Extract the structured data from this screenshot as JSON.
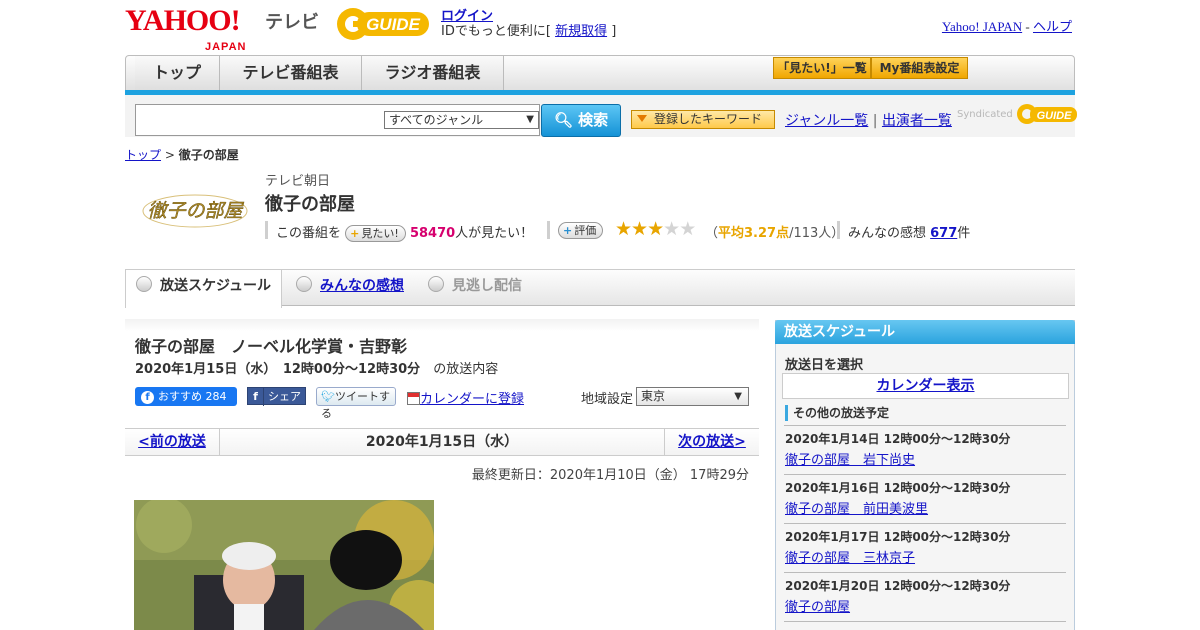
{
  "header": {
    "yahoo_logo": "YAHOO!",
    "yahoo_japan": "JAPAN",
    "tv_label": "テレビ",
    "gguide_logo": "GUIDE",
    "login": "ログイン",
    "id_text_prefix": "IDでもっと便利に[ ",
    "signup": "新規取得",
    "id_text_suffix": " ]",
    "yahoo_japan_link": "Yahoo! JAPAN",
    "sep": " - ",
    "help": "ヘルプ"
  },
  "nav": {
    "tabs": [
      "トップ",
      "テレビ番組表",
      "ラジオ番組表"
    ],
    "mitai_list": "「見たい!」一覧",
    "my_bangumi": "My番組表設定"
  },
  "search": {
    "genre_selected": "すべてのジャンル",
    "button": "検索",
    "keyword_button": "登録したキーワード",
    "genre_list": "ジャンル一覧",
    "divider": " | ",
    "performer_list": "出演者一覧",
    "syndicated": "Syndicated",
    "syndicated_logo": "GUIDE"
  },
  "breadcrumb": {
    "top": "トップ",
    "sep": " > ",
    "current": "徹子の部屋"
  },
  "program": {
    "logo_text": "徹子の部屋",
    "channel": "テレビ朝日",
    "title": "徹子の部屋",
    "mitai_prefix": "この番組を",
    "mitai_button": "見たい!",
    "mitai_count": "58470",
    "mitai_suffix": "人が見たい！",
    "hyoka_button": "評価",
    "rating_stars": 3,
    "rating_max": 5,
    "avg_open": "（",
    "avg_value": "平均3.27点",
    "avg_count": "/113人",
    "avg_close": "）",
    "kanso_label": "みんなの感想 ",
    "kanso_count": "677",
    "kanso_unit": "件"
  },
  "tabs": {
    "schedule": "放送スケジュール",
    "reviews": "みんなの感想",
    "streaming": "見逃し配信"
  },
  "episode": {
    "title": "徹子の部屋　ノーベル化学賞・吉野彰",
    "date": "2020年1月15日（水）　12時00分～12時30分",
    "date_suffix": "の放送内容",
    "fb_label": "おすすめ",
    "fb_count": "284",
    "share": "シェア",
    "tweet": "ツイートする",
    "calendar": "カレンダーに登録",
    "region_label": "地域設定",
    "region_value": "東京",
    "prev": "<前の放送",
    "current_date": "2020年1月15日（水）",
    "next": "次の放送>",
    "updated": "最終更新日：2020年1月10日（金）  17時29分"
  },
  "sidebar": {
    "heading": "放送スケジュール",
    "select_date": "放送日を選択",
    "calendar": "カレンダー表示",
    "other_heading": "その他の放送予定",
    "items": [
      {
        "date": "2020年1月14日  12時00分～12時30分",
        "title": "徹子の部屋　岩下尚史"
      },
      {
        "date": "2020年1月16日  12時00分～12時30分",
        "title": "徹子の部屋　前田美波里"
      },
      {
        "date": "2020年1月17日  12時00分～12時30分",
        "title": "徹子の部屋　三林京子"
      },
      {
        "date": "2020年1月20日  12時00分～12時30分",
        "title": "徹子の部屋"
      }
    ]
  },
  "colors": {
    "accent_blue": "#1ea2e0",
    "yahoo_red": "#e60012",
    "gguide_yellow": "#f5b800",
    "pink": "#d6006e",
    "star": "#e8a500"
  }
}
